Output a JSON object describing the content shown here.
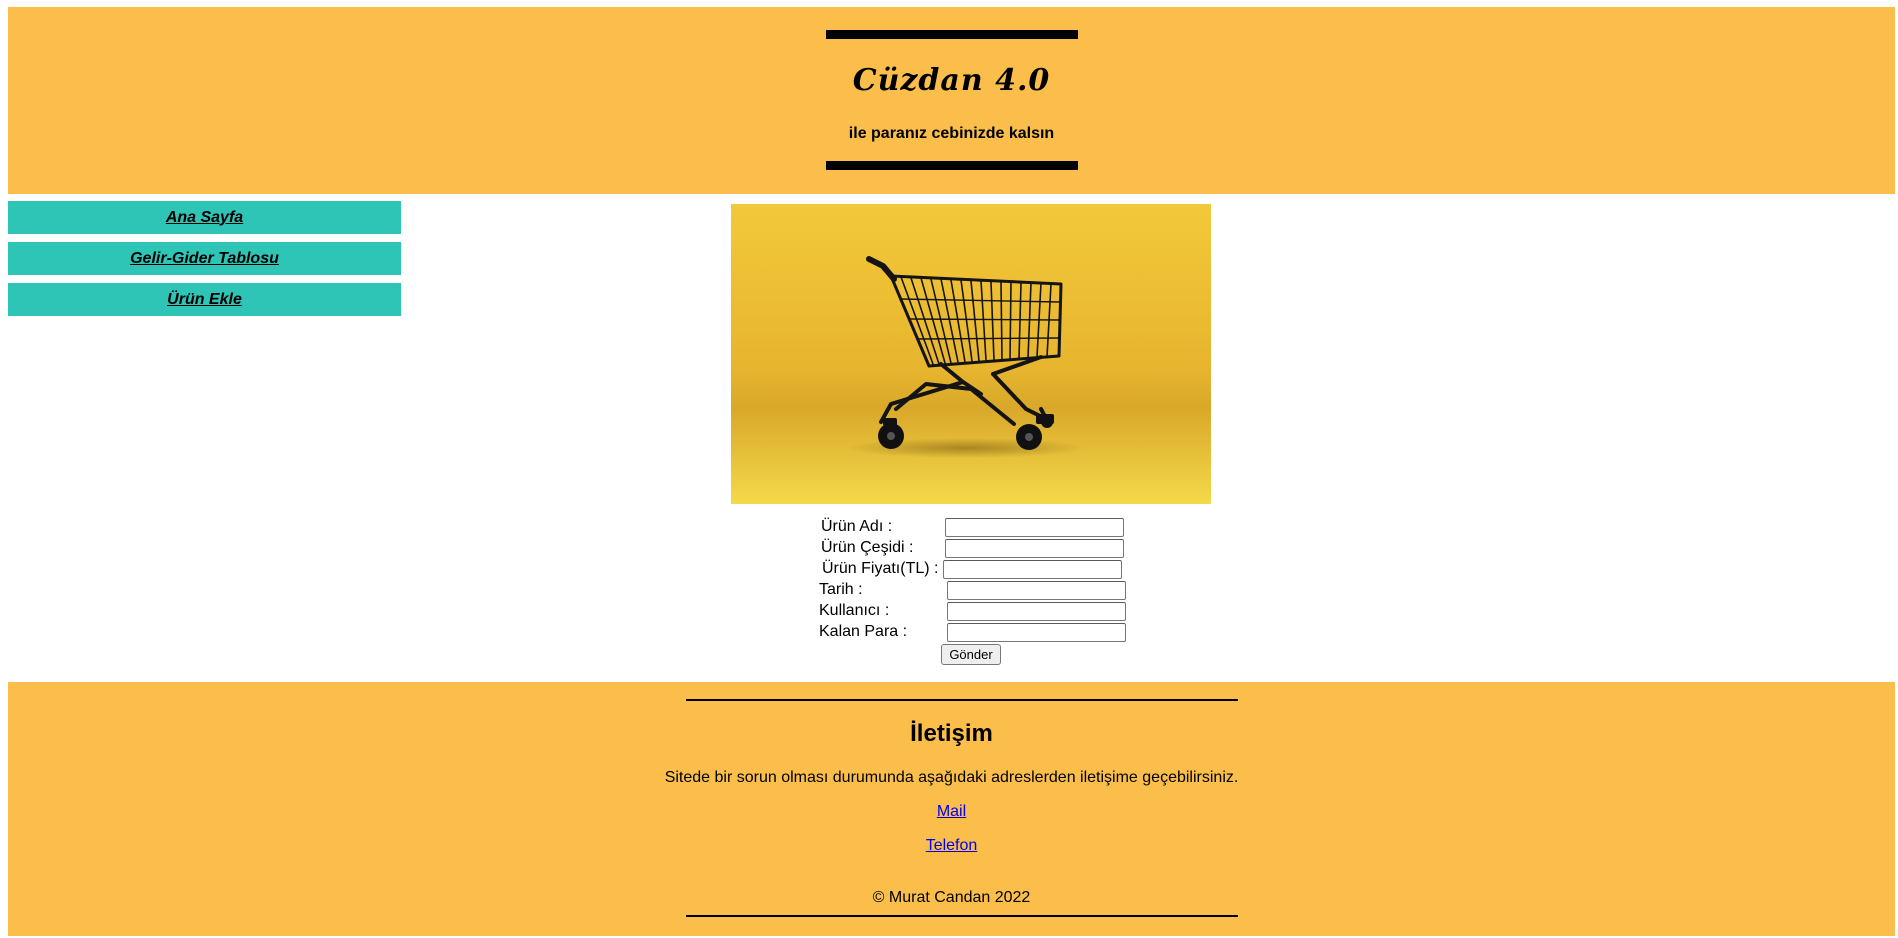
{
  "header": {
    "brand": "Cüzdan 4.0",
    "tagline": "ile paranız cebinizde kalsın"
  },
  "nav": {
    "items": [
      {
        "label": "Ana Sayfa"
      },
      {
        "label": "Gelir-Gider Tablosu"
      },
      {
        "label": "Ürün Ekle"
      }
    ]
  },
  "hero": {
    "icon": "shopping-cart-image"
  },
  "form": {
    "fields": [
      {
        "label": "Ürün Adı :",
        "value": ""
      },
      {
        "label": "Ürün Çeşidi :",
        "value": ""
      },
      {
        "label": "Ürün Fiyatı(TL) :",
        "value": ""
      },
      {
        "label": "Tarih :",
        "value": ""
      },
      {
        "label": "Kullanıcı :",
        "value": ""
      },
      {
        "label": "Kalan Para :",
        "value": ""
      }
    ],
    "submit_label": "Gönder"
  },
  "footer": {
    "title": "İletişim",
    "description": "Sitede bir sorun olması durumunda aşağıdaki adreslerden iletişime geçebilirsiniz.",
    "links": [
      {
        "label": "Mail"
      },
      {
        "label": "Telefon"
      }
    ],
    "copyright": "© Murat Candan 2022"
  },
  "colors": {
    "header_bg": "#fcbe4b",
    "nav_bg": "#2ec4b6",
    "link": "#0000ee"
  }
}
